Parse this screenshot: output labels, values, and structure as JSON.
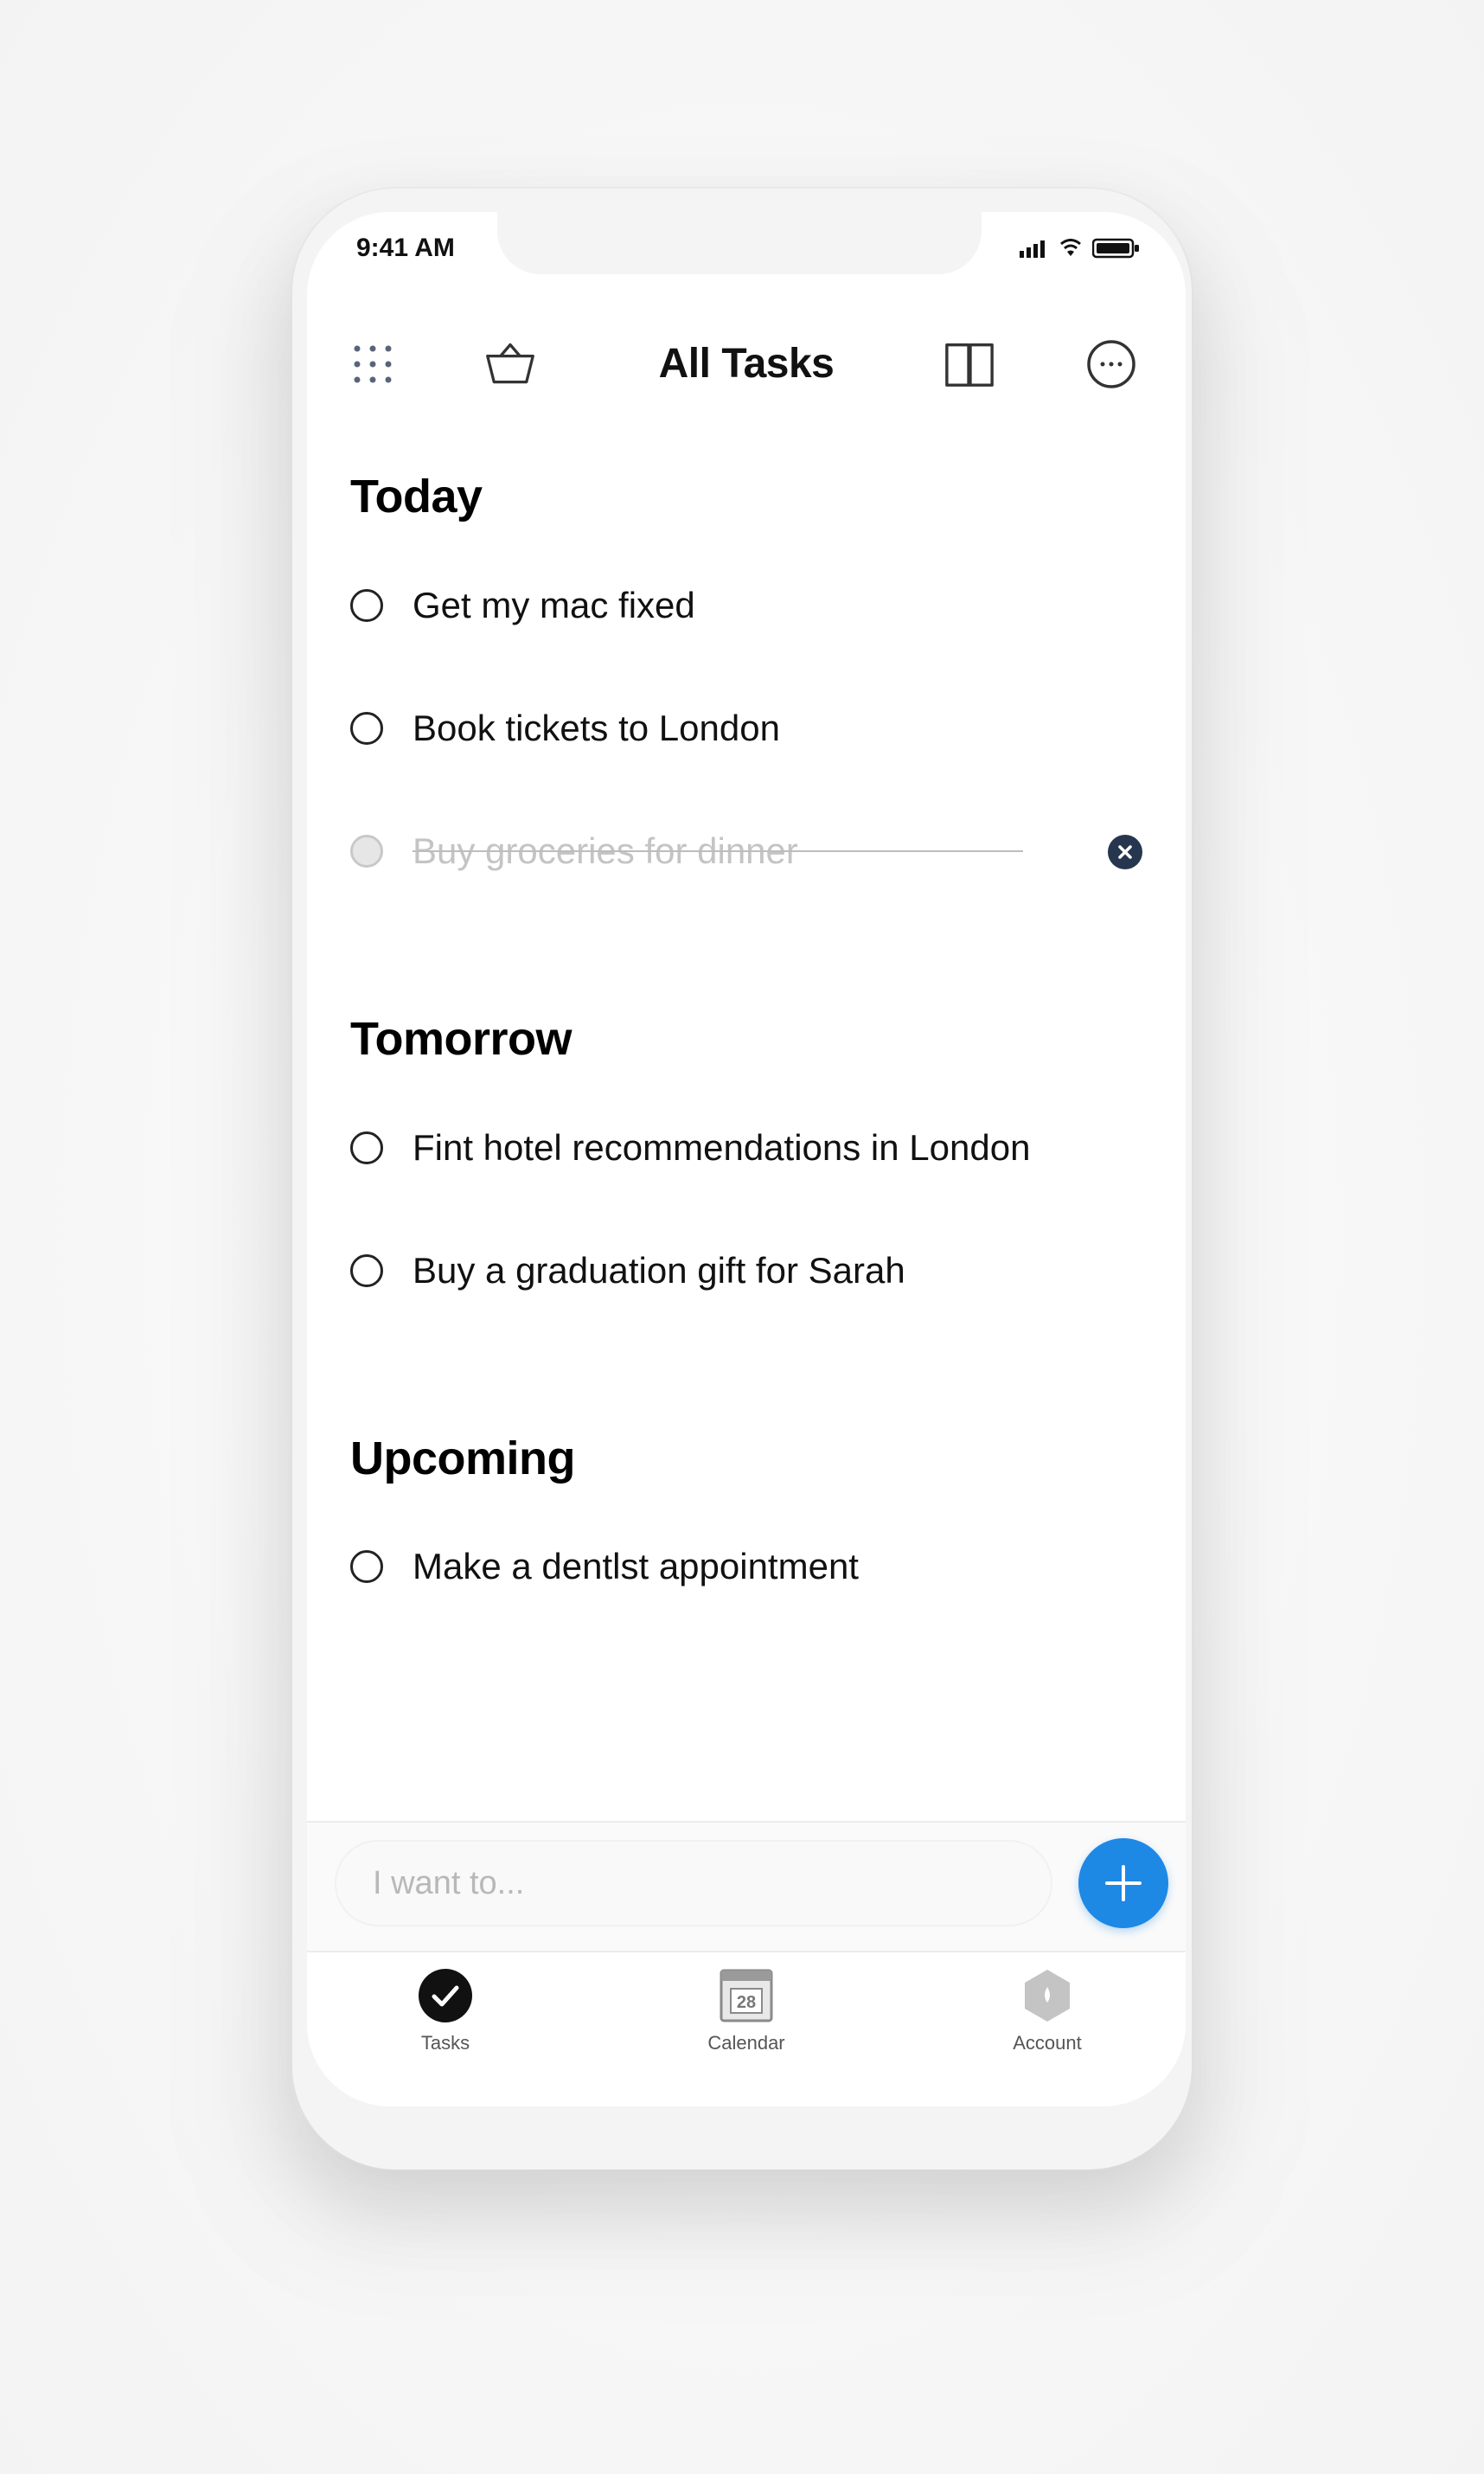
{
  "status_bar": {
    "time": "9:41 AM"
  },
  "nav": {
    "title": "All Tasks",
    "left_icons": [
      "grid-icon",
      "basket-icon"
    ],
    "right_icons": [
      "book-icon",
      "more-icon"
    ]
  },
  "sections": [
    {
      "title": "Today",
      "tasks": [
        {
          "label": "Get my mac fixed",
          "done": false
        },
        {
          "label": "Book tickets to London",
          "done": false
        },
        {
          "label": "Buy groceries for dinner",
          "done": true
        }
      ]
    },
    {
      "title": "Tomorrow",
      "tasks": [
        {
          "label": "Fint hotel recommendations in London",
          "done": false
        },
        {
          "label": "Buy a graduation gift for Sarah",
          "done": false
        }
      ]
    },
    {
      "title": "Upcoming",
      "tasks": [
        {
          "label": "Make a dentlst appointment",
          "done": false
        }
      ]
    }
  ],
  "composer": {
    "placeholder": "I want to..."
  },
  "tabbar": {
    "tabs": [
      {
        "label": "Tasks",
        "icon": "checkmark-circle-icon",
        "active": true
      },
      {
        "label": "Calendar",
        "icon": "calendar-icon",
        "active": false
      },
      {
        "label": "Account",
        "icon": "hexagon-icon",
        "active": false
      }
    ]
  },
  "colors": {
    "accent": "#1e88e5",
    "delete_badge": "#26364f",
    "text": "#111111",
    "done_text": "#c4c4c4"
  }
}
